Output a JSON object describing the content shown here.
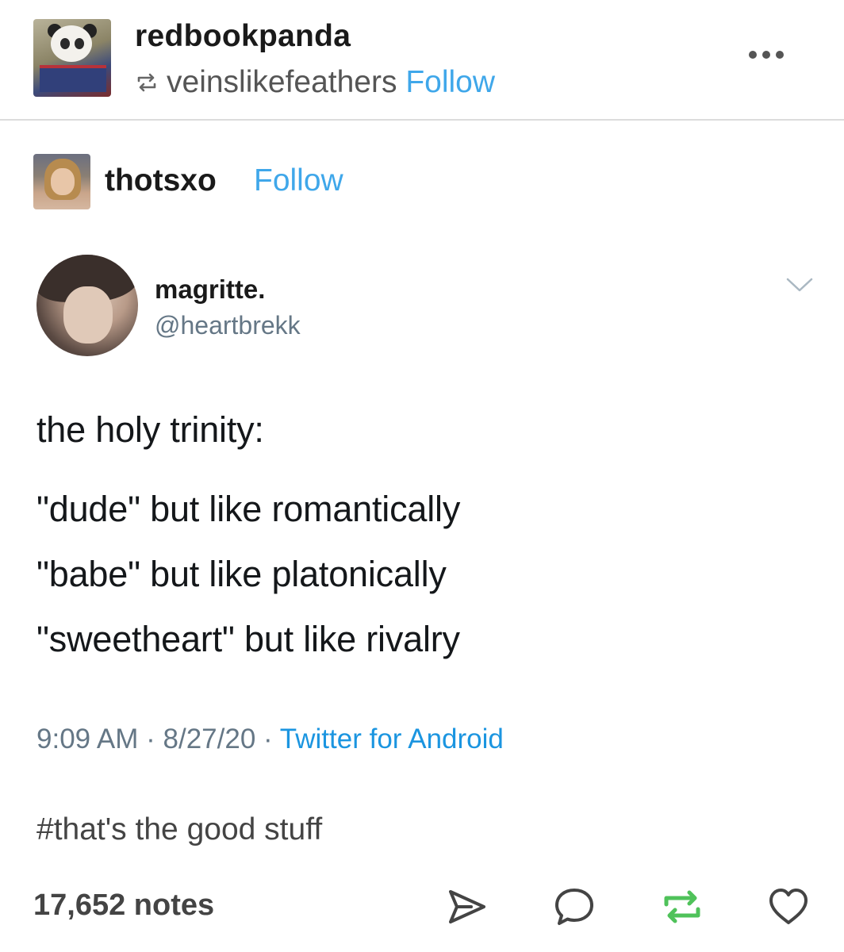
{
  "header": {
    "blog_name": "redbookpanda",
    "reblogged_from": "veinslikefeathers",
    "follow_label": "Follow",
    "more_icon": "more-horizontal-icon"
  },
  "reblog": {
    "user": "thotsxo",
    "follow_label": "Follow"
  },
  "tweet": {
    "display_name": "magritte.",
    "handle": "@heartbrekk",
    "lines": [
      "the holy trinity:",
      "\"dude\" but like romantically",
      "\"babe\" but like platonically",
      "\"sweetheart\" but like rivalry"
    ],
    "time": "9:09 AM",
    "date": "8/27/20",
    "source": "Twitter for Android",
    "sep": " · "
  },
  "tags": "#that's the good stuff",
  "footer": {
    "notes": "17,652 notes",
    "icons": [
      "share-icon",
      "reply-icon",
      "reblog-icon",
      "like-icon"
    ],
    "reblog_color": "#4fc25a"
  },
  "colors": {
    "link": "#3fa7ea",
    "twitter_link": "#1b95e0",
    "muted": "#657786"
  }
}
